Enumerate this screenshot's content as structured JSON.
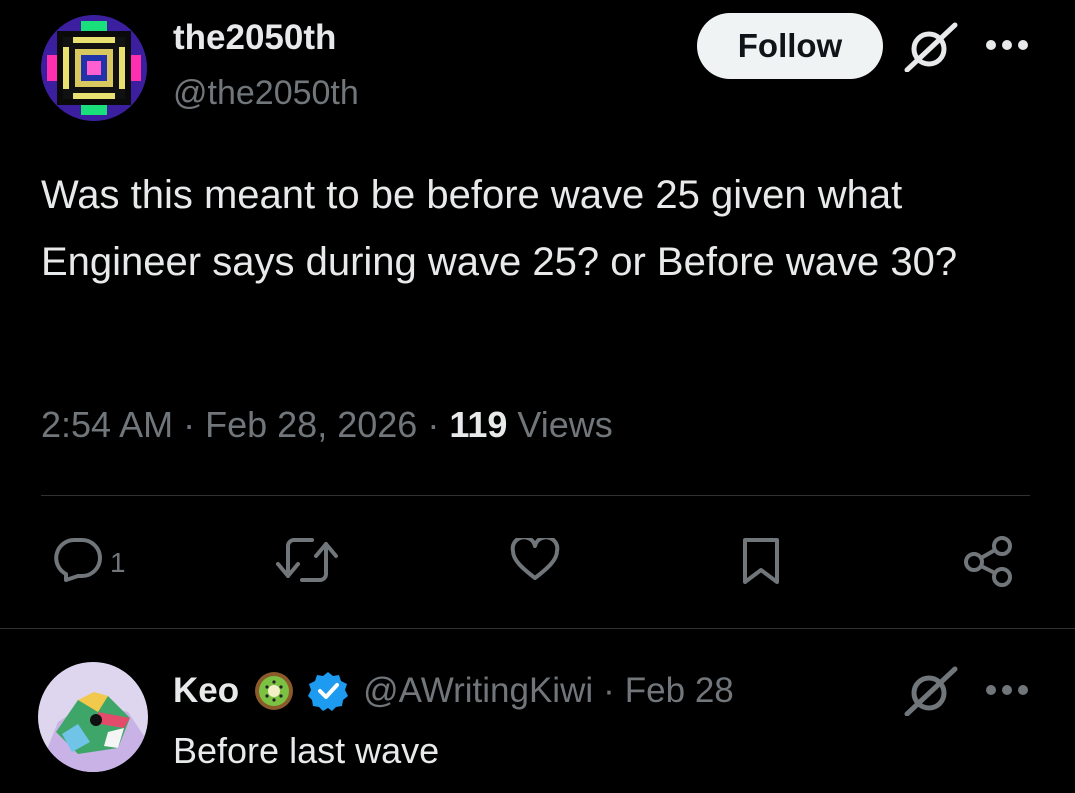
{
  "tweet": {
    "author": {
      "display_name": "the2050th",
      "handle": "@the2050th",
      "avatar_icon": "pixel-art-avatar"
    },
    "follow_label": "Follow",
    "text": "Was this meant to be before wave 25 given what Engineer says during wave 25? or Before wave 30?",
    "time": "2:54 AM",
    "dot": "·",
    "date": "Feb 28, 2026",
    "views_count": "119",
    "views_label": "Views",
    "actions": {
      "reply_count": "1",
      "reply_icon": "reply-icon",
      "retweet_icon": "retweet-icon",
      "like_icon": "heart-icon",
      "bookmark_icon": "bookmark-icon",
      "share_icon": "share-icon"
    }
  },
  "reply": {
    "display_name": "Keo",
    "handle": "@AWritingKiwi",
    "separator": "·",
    "date": "Feb 28",
    "text": "Before last wave",
    "badges": [
      "kiwi-icon",
      "verified-icon"
    ]
  },
  "colors": {
    "background": "#000000",
    "text_primary": "#e7e9ea",
    "text_secondary": "#71767b",
    "divider": "#2f3336",
    "verified_blue": "#1d9bf0",
    "follow_button_bg": "#eff3f4"
  }
}
